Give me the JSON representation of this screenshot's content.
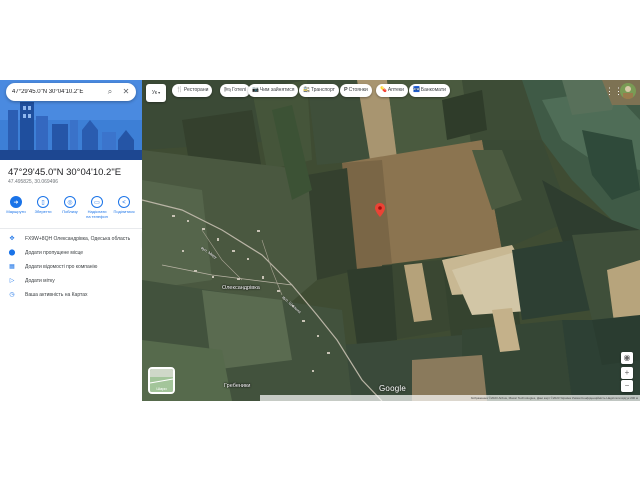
{
  "search": {
    "value": "47°29'45.0\"N 30°04'10.2\"E"
  },
  "place": {
    "title": "47°29'45.0\"N 30°04'10.2\"E",
    "decimal": "47.495825, 30.069496"
  },
  "actions": [
    {
      "label": "Маршрути",
      "icon": "directions-icon"
    },
    {
      "label": "Зберегти",
      "icon": "bookmark-icon"
    },
    {
      "label": "Поблизу",
      "icon": "nearby-icon"
    },
    {
      "label": "Надіслати на телефон",
      "icon": "phone-icon"
    },
    {
      "label": "Поділитися",
      "icon": "share-icon"
    }
  ],
  "info": [
    {
      "text": "FX9W+8QH Олександрівка, Одеська область",
      "icon": "plus-code-icon"
    },
    {
      "text": "Додати пропущене місце",
      "icon": "add-place-icon"
    },
    {
      "text": "Додати відомості про компанію",
      "icon": "business-icon"
    },
    {
      "text": "Додати мітку",
      "icon": "label-icon"
    },
    {
      "text": "Ваша активність на Картах",
      "icon": "history-icon"
    }
  ],
  "chips": [
    {
      "label": "Ресторани",
      "icon": "🍴"
    },
    {
      "label": "Готелі",
      "icon": "🛏"
    },
    {
      "label": "Чим зайнятися",
      "icon": "📷"
    },
    {
      "label": "Транспорт",
      "icon": "🚉"
    },
    {
      "label": "Стоянки",
      "icon": "P"
    },
    {
      "label": "Аптеки",
      "icon": "💊"
    },
    {
      "label": "Банкомати",
      "icon": "🏧"
    }
  ],
  "lang": "Ук",
  "map": {
    "places": [
      "Олександрівка",
      "Гребеники"
    ],
    "roads": [
      "вул. Миру",
      "вул. Шкільна"
    ],
    "brand": "Google",
    "footer": "Зображення ©2023 Airbus, Maxar Technologies, Дані карт ©2023   Україна   Умови   Конфіденційність   Надіслати відгук   200 м",
    "layers_label": "Шари"
  },
  "colors": {
    "accent": "#1a73e8",
    "pin": "#ea4335"
  }
}
